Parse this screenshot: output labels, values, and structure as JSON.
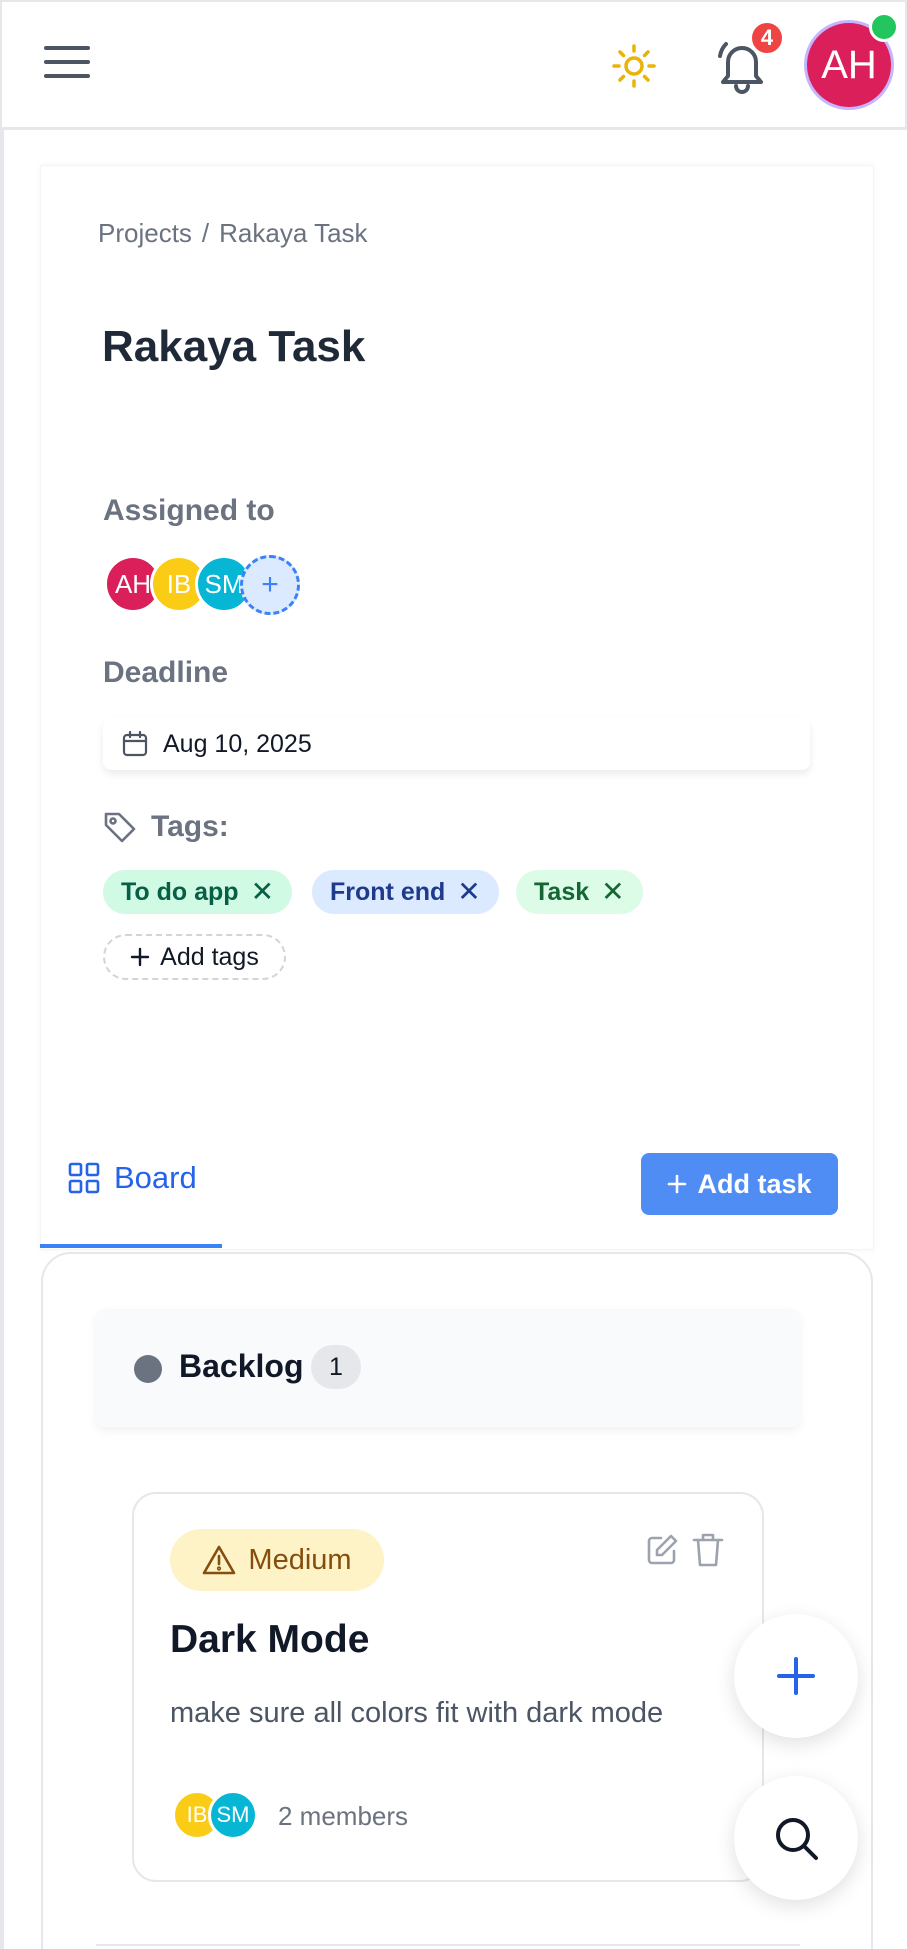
{
  "header": {
    "notification_count": "4",
    "user_initials": "AH",
    "colors": {
      "avatar": "#db1f5b",
      "online": "#22c55e",
      "badge": "#ef4444",
      "sun": "#eab308"
    }
  },
  "breadcrumb": {
    "root": "Projects",
    "separator": "/",
    "current": "Rakaya Task"
  },
  "project": {
    "title": "Rakaya Task",
    "assigned_label": "Assigned to",
    "assignees": [
      {
        "initials": "AH",
        "color": "#db1f5b"
      },
      {
        "initials": "IB",
        "color": "#facc15"
      },
      {
        "initials": "SM",
        "color": "#06b6d4"
      }
    ],
    "add_assignee_icon": "+",
    "deadline_label": "Deadline",
    "deadline_value": "Aug 10, 2025",
    "tags_label": "Tags:",
    "tags": [
      {
        "label": "To do app",
        "bg": "#d1fae5",
        "fg": "#065f46"
      },
      {
        "label": "Front end",
        "bg": "#dbeafe",
        "fg": "#1e3a8a"
      },
      {
        "label": "Task",
        "bg": "#dcfce7",
        "fg": "#166534"
      }
    ],
    "tag_remove": "✕",
    "add_tags_label": "Add tags"
  },
  "tabs": {
    "board_label": "Board",
    "add_task_label": "Add task",
    "accent": "#2563eb"
  },
  "board": {
    "column": {
      "title": "Backlog",
      "count": "1"
    },
    "task": {
      "priority": "Medium",
      "title": "Dark Mode",
      "description": "make sure all colors fit with dark mode",
      "members": [
        {
          "initials": "IB",
          "color": "#facc15"
        },
        {
          "initials": "SM",
          "color": "#06b6d4"
        }
      ],
      "members_text": "2 members"
    }
  },
  "icons": [
    "menu-icon",
    "sun-icon",
    "bell-icon",
    "calendar-icon",
    "tag-icon",
    "grid-icon",
    "plus-icon",
    "warning-icon",
    "edit-icon",
    "trash-icon",
    "search-icon"
  ]
}
